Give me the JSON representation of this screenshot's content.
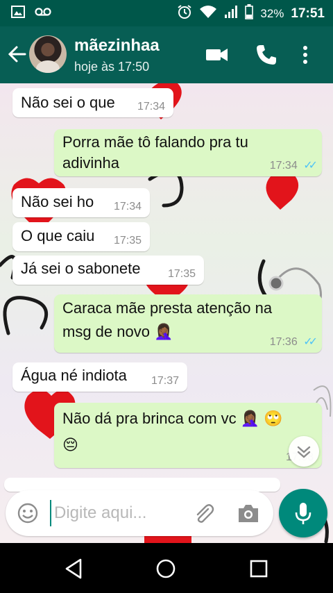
{
  "status_bar": {
    "battery_percent": "32%",
    "time": "17:51"
  },
  "header": {
    "contact_name": "mãezinhaa",
    "last_seen": "hoje às 17:50"
  },
  "messages": [
    {
      "direction": "in",
      "text": "Não sei o que",
      "time": "17:34"
    },
    {
      "direction": "out",
      "line1": "Porra mãe tô falando pra tu",
      "line2": "adivinha",
      "time": "17:34",
      "status": "read"
    },
    {
      "direction": "in",
      "text": "Não sei ho",
      "time": "17:34"
    },
    {
      "direction": "in",
      "text": "O que caiu",
      "time": "17:35"
    },
    {
      "direction": "in",
      "text": "Já sei o sabonete",
      "time": "17:35"
    },
    {
      "direction": "out",
      "line1": "Caraca mãe presta atenção na",
      "line2": "msg de novo",
      "emoji": "🤦🏾‍♀️",
      "time": "17:36",
      "status": "read"
    },
    {
      "direction": "in",
      "text": "Água né indiota",
      "time": "17:37"
    },
    {
      "direction": "out",
      "line1": "Não dá pra brinca com vc",
      "emoji1": "🤦🏾‍♀️",
      "emoji2": "🙄",
      "emoji3": "😔",
      "time": "17:38"
    }
  ],
  "composer": {
    "placeholder": "Digite aqui..."
  },
  "colors": {
    "header": "#075e54",
    "status_bar": "#00574a",
    "outgoing_bubble": "#dcf8c6",
    "incoming_bubble": "#ffffff",
    "accent": "#00897b",
    "read_ticks": "#4fc3f7"
  },
  "icons": [
    "image-icon",
    "voicemail-icon",
    "alarm-icon",
    "wifi-icon",
    "signal-icon",
    "battery-icon",
    "back-arrow-icon",
    "video-call-icon",
    "phone-icon",
    "more-vert-icon",
    "emoji-icon",
    "attach-icon",
    "camera-icon",
    "mic-icon",
    "chevron-down-icon",
    "nav-back-icon",
    "nav-home-icon",
    "nav-recents-icon"
  ]
}
